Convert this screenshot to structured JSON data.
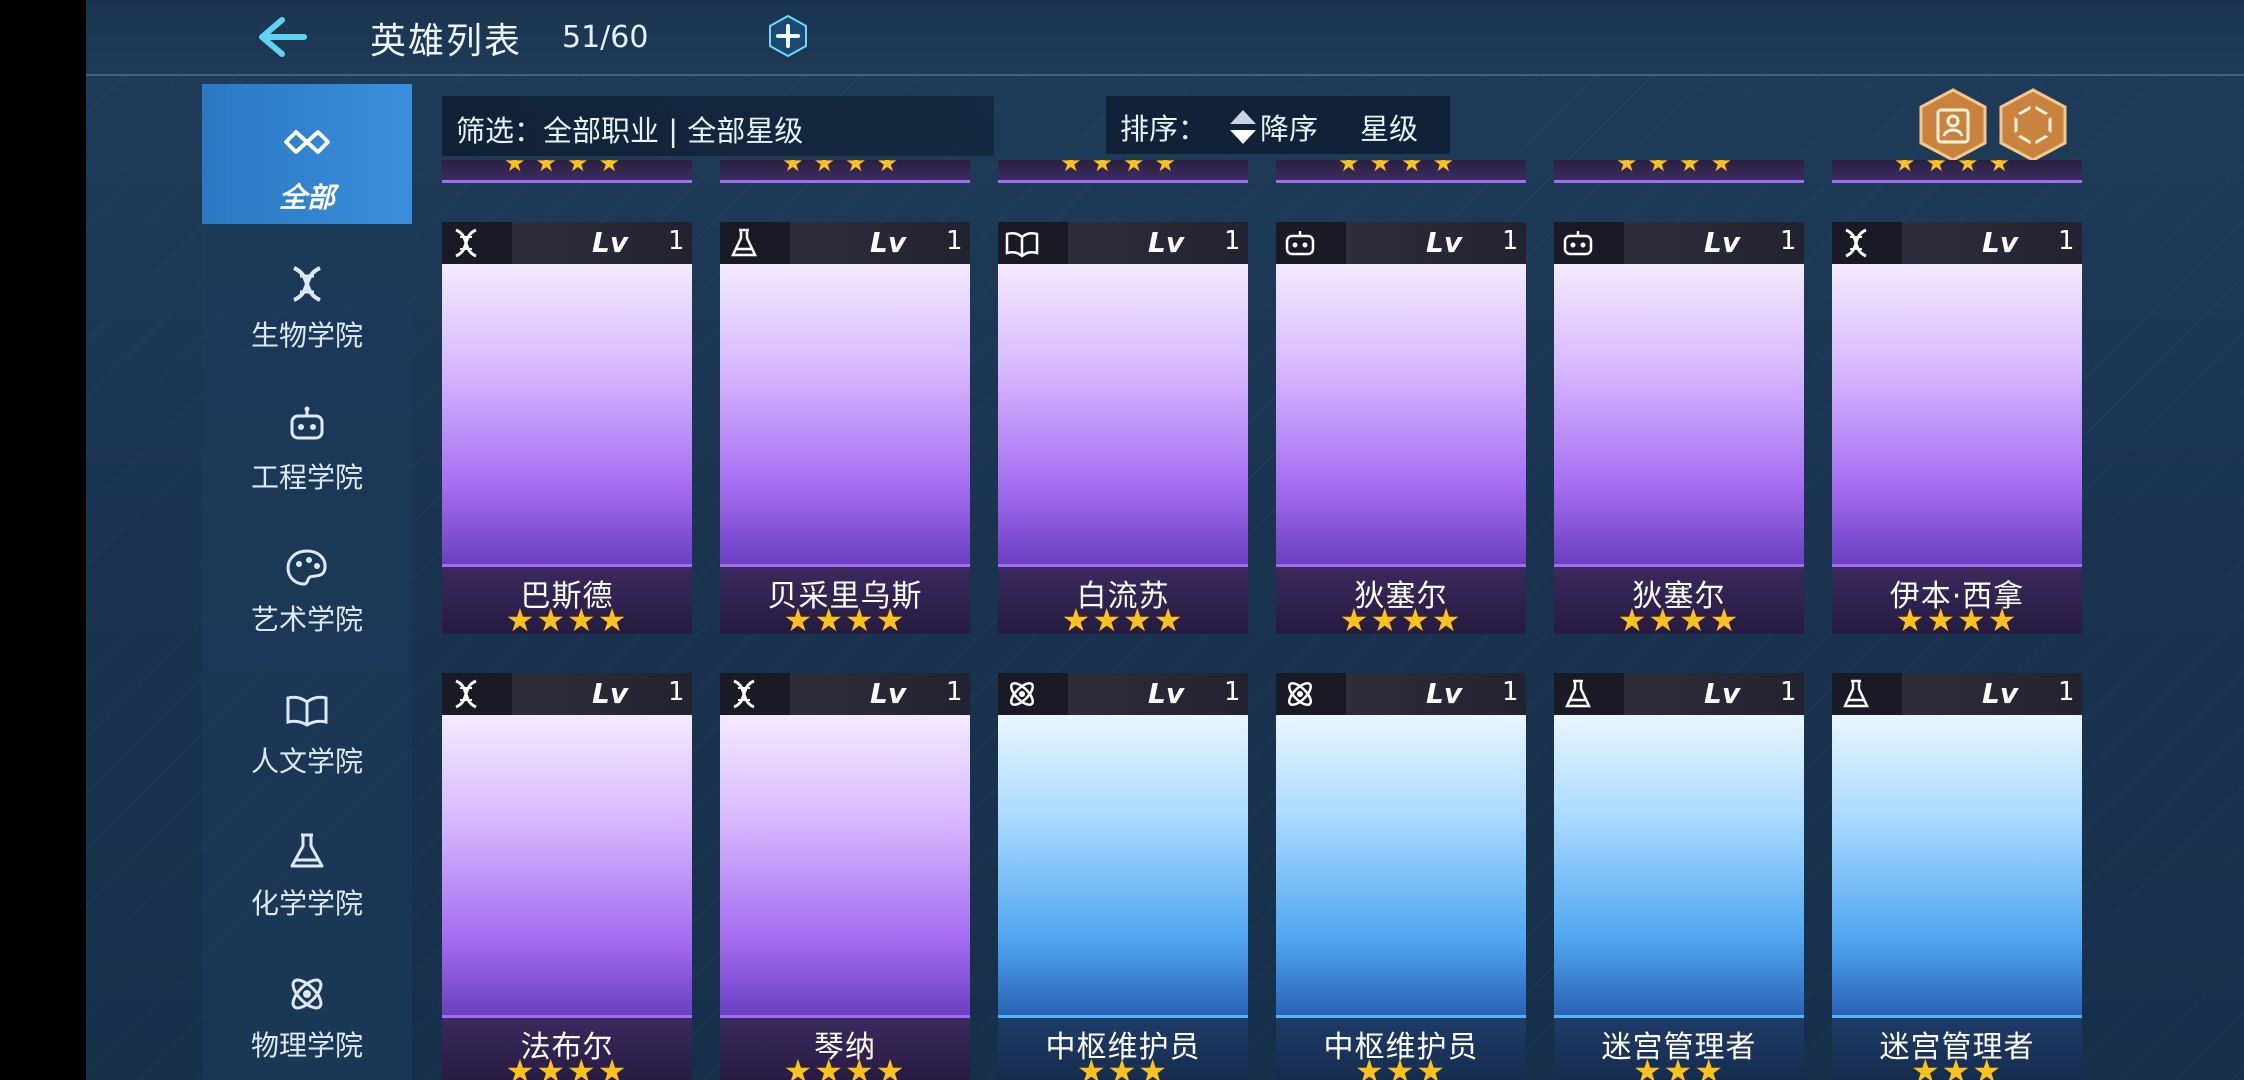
{
  "header": {
    "title": "英雄列表",
    "count": "51/60"
  },
  "sidebar": {
    "items": [
      {
        "label": "全部",
        "icon": "infinity-icon",
        "active": true
      },
      {
        "label": "生物学院",
        "icon": "dna-icon"
      },
      {
        "label": "工程学院",
        "icon": "robot-icon"
      },
      {
        "label": "艺术学院",
        "icon": "palette-icon"
      },
      {
        "label": "人文学院",
        "icon": "book-icon"
      },
      {
        "label": "化学学院",
        "icon": "flask-icon"
      },
      {
        "label": "物理学院",
        "icon": "atom-icon"
      }
    ]
  },
  "filter": {
    "text": "筛选：全部职业 | 全部星级"
  },
  "sort": {
    "label": "排序：",
    "direction": "降序",
    "key": "星级"
  },
  "lv_label": "Lv",
  "cards": [
    {
      "name": "巴斯德",
      "level": "1",
      "stars": "★★★★",
      "class_icon": "dna-icon",
      "theme": "purple"
    },
    {
      "name": "贝采里乌斯",
      "level": "1",
      "stars": "★★★★",
      "class_icon": "flask-icon",
      "theme": "purple"
    },
    {
      "name": "白流苏",
      "level": "1",
      "stars": "★★★★",
      "class_icon": "book-icon",
      "theme": "purple"
    },
    {
      "name": "狄塞尔",
      "level": "1",
      "stars": "★★★★",
      "class_icon": "robot-icon",
      "theme": "purple"
    },
    {
      "name": "狄塞尔",
      "level": "1",
      "stars": "★★★★",
      "class_icon": "robot-icon",
      "theme": "purple"
    },
    {
      "name": "伊本·西拿",
      "level": "1",
      "stars": "★★★★",
      "class_icon": "dna-icon",
      "theme": "purple"
    },
    {
      "name": "法布尔",
      "level": "1",
      "stars": "★★★★",
      "class_icon": "dna-icon",
      "theme": "purple"
    },
    {
      "name": "琴纳",
      "level": "1",
      "stars": "★★★★",
      "class_icon": "dna-icon",
      "theme": "purple"
    },
    {
      "name": "中枢维护员",
      "level": "1",
      "stars": "★★★",
      "class_icon": "atom-icon",
      "theme": "blue"
    },
    {
      "name": "中枢维护员",
      "level": "1",
      "stars": "★★★",
      "class_icon": "atom-icon",
      "theme": "blue"
    },
    {
      "name": "迷宫管理者",
      "level": "1",
      "stars": "★★★",
      "class_icon": "flask-icon",
      "theme": "blue"
    },
    {
      "name": "迷宫管理者",
      "level": "1",
      "stars": "★★★",
      "class_icon": "flask-icon",
      "theme": "blue"
    }
  ],
  "colors": {
    "star": "#ffc21c",
    "purple_accent": "#a46cf0",
    "blue_accent": "#4fb4ff",
    "active_tab": "#2a78c2"
  }
}
